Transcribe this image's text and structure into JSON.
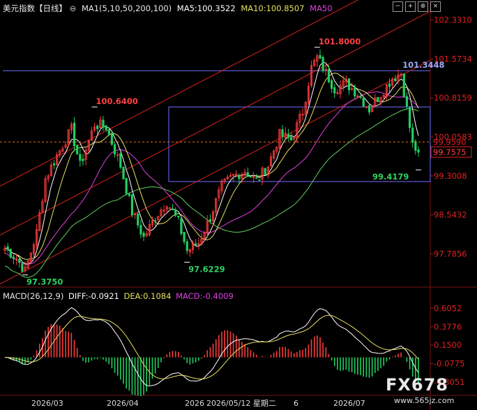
{
  "header": {
    "symbol": "美元指数",
    "period": "【日线】",
    "zoom_icon": "zoom-icon",
    "ma_title": "MA1(5,10,50,200,100)",
    "ma5": "MA5:100.3522",
    "ma10": "MA10:100.8507",
    "ma50": "MA50"
  },
  "toolbar": {
    "icons": [
      "minus-icon",
      "plus-icon",
      "crosshair-icon",
      "close-icon"
    ],
    "glyphs": [
      "−",
      "+",
      "⊕",
      "×"
    ]
  },
  "macd_header": {
    "title": "MACD(26,12,9)",
    "diff": "DIFF:-0.0921",
    "dea": "DEA:0.1084",
    "macd": "MACD:-0.4009"
  },
  "colors": {
    "background": "#000000",
    "up": "#ff3b3b",
    "down": "#20d060",
    "ma5": "#ffffff",
    "ma10": "#e8e060",
    "ma50": "#e040e0",
    "ma100": "#60d060",
    "rect": "#7070ff",
    "channel": "#d82020",
    "axis_text": "#e02020",
    "level_high": "#ff4040",
    "level_low": "#30d060"
  },
  "chart_data": {
    "type": "candlestick",
    "price_axis": {
      "ylim": [
        97.18,
        102.42
      ],
      "ticks": [
        "102.3310",
        "101.5734",
        "100.8159",
        "100.0583",
        "99.3008",
        "98.5432",
        "97.7856"
      ]
    },
    "current_price": "99.9590",
    "last_price": "99.7575",
    "annotations": [
      {
        "label": "101.8000",
        "kind": "high"
      },
      {
        "label": "100.6400",
        "kind": "high"
      },
      {
        "label": "101.3448",
        "kind": "level"
      },
      {
        "label": "99.4179",
        "kind": "low"
      },
      {
        "label": "97.6229",
        "kind": "low"
      },
      {
        "label": "97.3750",
        "kind": "low"
      }
    ],
    "horizontal_levels": [
      101.3448
    ],
    "range_box": {
      "top": 100.64,
      "bottom": 99.19
    },
    "channel": {
      "start_value": 97.2,
      "end_value": 101.55,
      "offsets": [
        0,
        0.95,
        1.9
      ]
    },
    "x_labels": [
      "2026/03",
      "2026/04",
      "2026",
      "2026/05/12 星期二",
      "6",
      "2026/07"
    ],
    "macd_axis": {
      "ylim": [
        -0.46,
        0.72
      ],
      "ticks": [
        "0.6052",
        "0.3776",
        "0.1500",
        "-0.0775",
        "-0.3051"
      ]
    },
    "anchors": [
      {
        "i": 0,
        "v": 97.9
      },
      {
        "i": 4,
        "v": 97.7
      },
      {
        "i": 7,
        "v": 97.45
      },
      {
        "i": 11,
        "v": 98.2
      },
      {
        "i": 14,
        "v": 99.25
      },
      {
        "i": 18,
        "v": 99.7
      },
      {
        "i": 23,
        "v": 100.2
      },
      {
        "i": 26,
        "v": 99.5
      },
      {
        "i": 31,
        "v": 100.3
      },
      {
        "i": 35,
        "v": 100.25
      },
      {
        "i": 40,
        "v": 99.5
      },
      {
        "i": 44,
        "v": 98.6
      },
      {
        "i": 48,
        "v": 98.1
      },
      {
        "i": 52,
        "v": 98.5
      },
      {
        "i": 56,
        "v": 98.8
      },
      {
        "i": 60,
        "v": 98.4
      },
      {
        "i": 63,
        "v": 97.85
      },
      {
        "i": 67,
        "v": 98.0
      },
      {
        "i": 71,
        "v": 98.5
      },
      {
        "i": 75,
        "v": 99.1
      },
      {
        "i": 79,
        "v": 99.3
      },
      {
        "i": 83,
        "v": 99.4
      },
      {
        "i": 87,
        "v": 99.2
      },
      {
        "i": 91,
        "v": 99.5
      },
      {
        "i": 95,
        "v": 100.1
      },
      {
        "i": 99,
        "v": 100.0
      },
      {
        "i": 103,
        "v": 100.55
      },
      {
        "i": 106,
        "v": 101.4
      },
      {
        "i": 108,
        "v": 101.6
      },
      {
        "i": 111,
        "v": 101.3
      },
      {
        "i": 114,
        "v": 101.0
      },
      {
        "i": 118,
        "v": 101.1
      },
      {
        "i": 122,
        "v": 100.9
      },
      {
        "i": 126,
        "v": 100.6
      },
      {
        "i": 130,
        "v": 100.9
      },
      {
        "i": 134,
        "v": 101.2
      },
      {
        "i": 137,
        "v": 101.3
      },
      {
        "i": 139,
        "v": 100.6
      },
      {
        "i": 141,
        "v": 99.9
      },
      {
        "i": 143,
        "v": 99.76
      }
    ],
    "bar_count": 144
  },
  "watermark": {
    "brand": "FX678",
    "url": "www.565jz.com"
  }
}
